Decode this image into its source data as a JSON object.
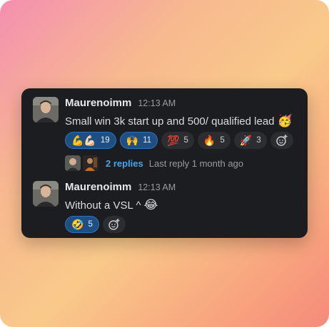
{
  "messages": [
    {
      "user": "Maurenoimm",
      "time": "12:13 AM",
      "text": "Small win 3k start up and 500/ qualified lead",
      "text_emoji": "🥳",
      "reactions": [
        {
          "emoji": "💪💪🏻",
          "count": "19",
          "active": true
        },
        {
          "emoji": "🙌",
          "count": "11",
          "active": true
        },
        {
          "emoji": "💯",
          "count": "5",
          "active": false
        },
        {
          "emoji": "🔥",
          "count": "5",
          "active": false
        },
        {
          "emoji": "🚀",
          "count": "3",
          "active": false
        }
      ],
      "thread": {
        "replies": "2 replies",
        "last_reply": "Last reply 1 month ago"
      }
    },
    {
      "user": "Maurenoimm",
      "time": "12:13 AM",
      "text": "Without a VSL ^",
      "text_emoji": "😂",
      "reactions": [
        {
          "emoji": "🤣",
          "count": "5",
          "active": true
        }
      ]
    }
  ],
  "icons": {
    "add_reaction": "add-reaction-icon"
  },
  "colors": {
    "card": "#1b1d21",
    "link": "#4da3e8",
    "active_reaction": "#1f4f82"
  }
}
